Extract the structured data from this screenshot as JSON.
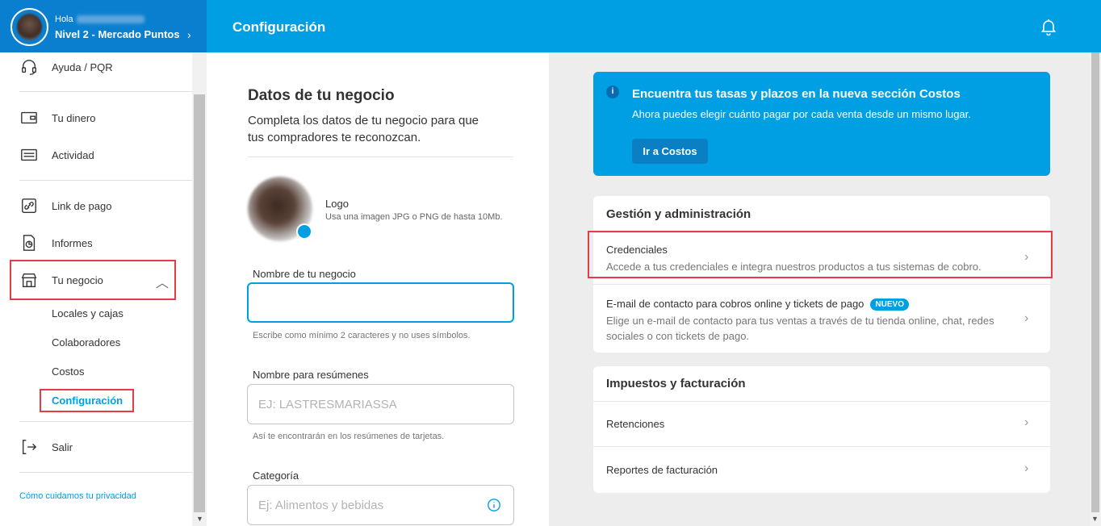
{
  "header": {
    "greeting": "Hola",
    "level": "Nivel 2 - Mercado Puntos",
    "title": "Configuración"
  },
  "sidebar": {
    "items": [
      {
        "label": "Ayuda / PQR",
        "icon": "headset-icon"
      },
      {
        "label": "Tu dinero",
        "icon": "wallet-icon"
      },
      {
        "label": "Actividad",
        "icon": "activity-icon"
      },
      {
        "label": "Link de pago",
        "icon": "link-icon"
      },
      {
        "label": "Informes",
        "icon": "report-icon"
      },
      {
        "label": "Tu negocio",
        "icon": "store-icon"
      },
      {
        "label": "Salir",
        "icon": "logout-icon"
      }
    ],
    "subitems": [
      "Locales y cajas",
      "Colaboradores",
      "Costos",
      "Configuración"
    ],
    "privacy_link": "Cómo cuidamos tu privacidad"
  },
  "business": {
    "title": "Datos de tu negocio",
    "description": "Completa los datos de tu negocio para que tus compradores te reconozcan.",
    "logo_label": "Logo",
    "logo_hint": "Usa una imagen JPG o PNG de hasta 10Mb.",
    "name_label": "Nombre de tu negocio",
    "name_value": "",
    "name_hint": "Escribe como mínimo 2 caracteres y no uses símbolos.",
    "summary_label": "Nombre para resúmenes",
    "summary_placeholder": "EJ: LASTRESMARIASSA",
    "summary_hint": "Así te encontrarán en los resúmenes de tarjetas.",
    "category_label": "Categoría",
    "category_placeholder": "Ej: Alimentos y bebidas"
  },
  "banner": {
    "title": "Encuentra tus tasas y plazos en la nueva sección Costos",
    "text": "Ahora puedes elegir cuánto pagar por cada venta desde un mismo lugar.",
    "button": "Ir a Costos"
  },
  "management": {
    "title": "Gestión y administración",
    "credentials_title": "Credenciales",
    "credentials_desc": "Accede a tus credenciales e integra nuestros productos a tus sistemas de cobro.",
    "email_title": "E-mail de contacto para cobros online y tickets de pago",
    "email_badge": "NUEVO",
    "email_desc": "Elige un e-mail de contacto para tus ventas a través de tu tienda online, chat, redes sociales o con tickets de pago."
  },
  "taxes": {
    "title": "Impuestos y facturación",
    "row1": "Retenciones",
    "row2": "Reportes de facturación"
  },
  "colors": {
    "primary": "#009ee3",
    "header_dark": "#0a7fd0",
    "highlight": "#e63c46"
  }
}
